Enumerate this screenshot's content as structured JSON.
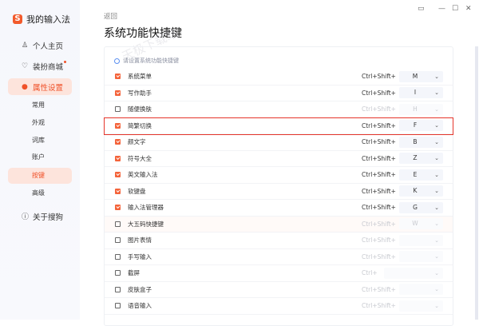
{
  "app": {
    "title": "我的输入法",
    "logo_glyph": "S"
  },
  "sidebar": {
    "items": [
      {
        "label": "个人主页",
        "icon": "user-icon"
      },
      {
        "label": "装扮商城",
        "icon": "shirt-icon",
        "badge": true
      },
      {
        "label": "属性设置",
        "icon": "settings-icon",
        "active": true
      },
      {
        "label": "关于搜狗",
        "icon": "info-icon"
      }
    ],
    "subitems": [
      "常用",
      "外观",
      "词库",
      "账户",
      "按键",
      "高级"
    ],
    "active_sub": "按键"
  },
  "header": {
    "back": "返回",
    "title": "系统功能快捷键"
  },
  "panel": {
    "hint": "请设置系统功能快捷键",
    "rows": [
      {
        "name": "系统菜单",
        "checked": true,
        "mod": "Ctrl+Shift+",
        "key": "M"
      },
      {
        "name": "写作助手",
        "checked": true,
        "mod": "Ctrl+Shift+",
        "key": "I"
      },
      {
        "name": "随便换肤",
        "checked": false,
        "mod": "Ctrl+Shift+",
        "key": "H"
      },
      {
        "name": "简繁切换",
        "checked": true,
        "mod": "Ctrl+Shift+",
        "key": "F"
      },
      {
        "name": "颜文字",
        "checked": true,
        "mod": "Ctrl+Shift+",
        "key": "B"
      },
      {
        "name": "符号大全",
        "checked": true,
        "mod": "Ctrl+Shift+",
        "key": "Z"
      },
      {
        "name": "英文输入法",
        "checked": true,
        "mod": "Ctrl+Shift+",
        "key": "E"
      },
      {
        "name": "软键盘",
        "checked": true,
        "mod": "Ctrl+Shift+",
        "key": "K"
      },
      {
        "name": "输入法管理器",
        "checked": true,
        "mod": "Ctrl+Shift+",
        "key": "G"
      },
      {
        "name": "大五码快捷键",
        "checked": false,
        "mod": "Ctrl+Shift+",
        "key": "W"
      },
      {
        "name": "图片表情",
        "checked": false,
        "mod": "Ctrl+Shift+",
        "key": ""
      },
      {
        "name": "手写输入",
        "checked": false,
        "mod": "Ctrl+Shift+",
        "key": ""
      },
      {
        "name": "截屏",
        "checked": false,
        "mod": "Ctrl+",
        "key": ""
      },
      {
        "name": "皮肤盒子",
        "checked": false,
        "mod": "Ctrl+Shift+",
        "key": ""
      },
      {
        "name": "语音输入",
        "checked": false,
        "mod": "Ctrl+Shift+",
        "key": ""
      }
    ]
  },
  "watermark": "天极下载站",
  "colors": {
    "accent": "#f4633a",
    "highlight": "#e5352b"
  }
}
